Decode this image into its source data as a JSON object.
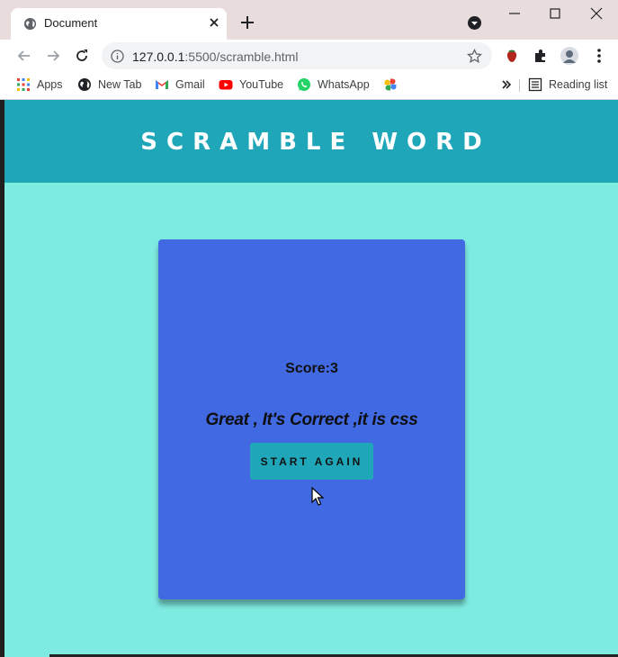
{
  "browser": {
    "tab_title": "Document",
    "url_host": "127.0.0.1",
    "url_path": ":5500/scramble.html",
    "bookmarks": [
      {
        "label": "Apps",
        "icon": "apps-grid-icon"
      },
      {
        "label": "New Tab",
        "icon": "globe-icon"
      },
      {
        "label": "Gmail",
        "icon": "gmail-icon"
      },
      {
        "label": "YouTube",
        "icon": "youtube-icon"
      },
      {
        "label": "WhatsApp",
        "icon": "whatsapp-icon"
      }
    ],
    "reading_list_label": "Reading list"
  },
  "page": {
    "title": "SCRAMBLE WORD",
    "score_text": "Score:3",
    "message": "Great , It's Correct ,it is css",
    "start_again_label": "START AGAIN"
  },
  "colors": {
    "header_bg": "#1fa7b9",
    "page_bg": "#7eebe1",
    "card_bg": "#4169e1",
    "button_bg": "#1fa7b9"
  }
}
